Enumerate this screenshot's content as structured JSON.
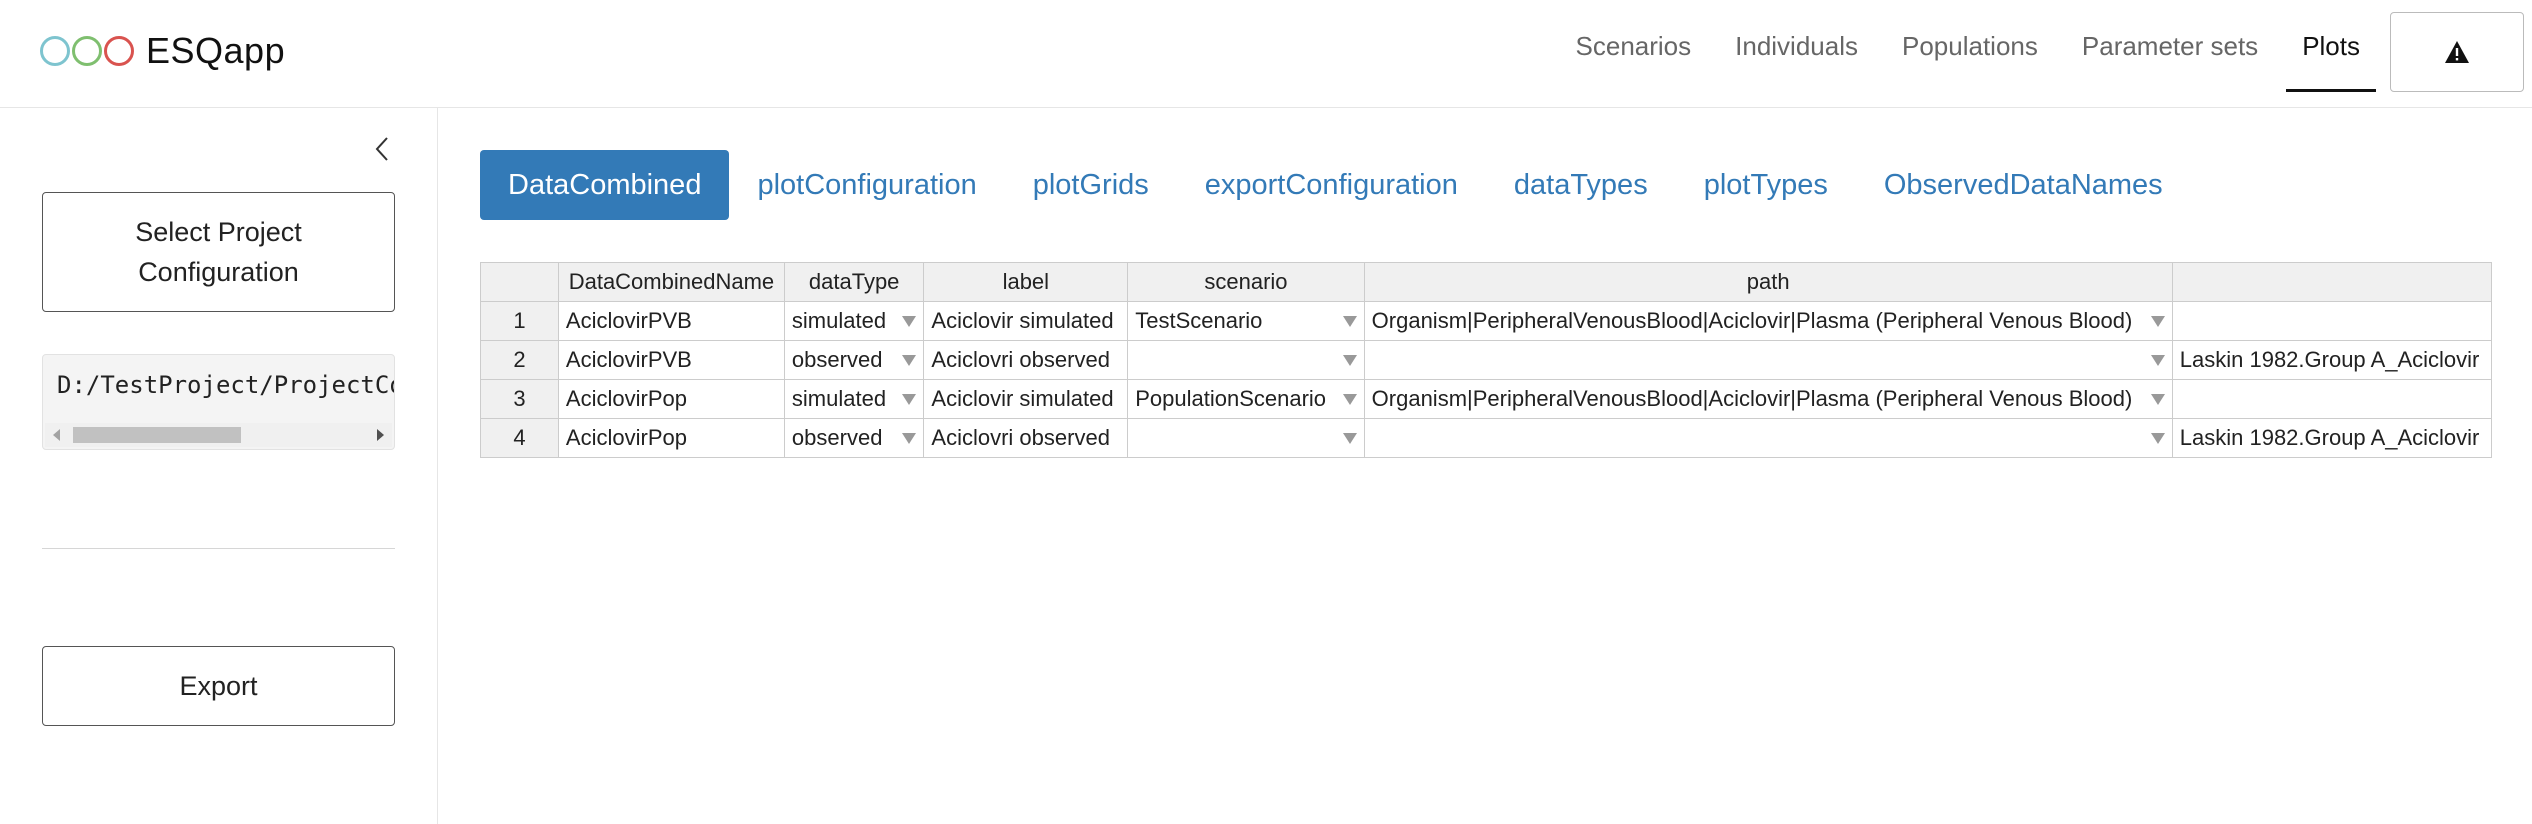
{
  "app": {
    "title": "ESQapp",
    "logo_colors": [
      "#7ec4cf",
      "#7fbf6f",
      "#d9534f"
    ]
  },
  "nav": {
    "items": [
      "Scenarios",
      "Individuals",
      "Populations",
      "Parameter sets",
      "Plots"
    ],
    "active": "Plots",
    "warning_icon": "warning-triangle-icon"
  },
  "sidebar": {
    "collapse_icon": "chevron-left-icon",
    "select_label": "Select Project Configuration",
    "path_value": "D:/TestProject/ProjectConfiguration.xlsx",
    "export_label": "Export"
  },
  "tabs": {
    "items": [
      "DataCombined",
      "plotConfiguration",
      "plotGrids",
      "exportConfiguration",
      "dataTypes",
      "plotTypes",
      "ObservedDataNames"
    ],
    "active": "DataCombined"
  },
  "table": {
    "columns": [
      "",
      "DataCombinedName",
      "dataType",
      "label",
      "scenario",
      "path",
      ""
    ],
    "rows": [
      [
        "1",
        "AciclovirPVB",
        "simulated",
        "Aciclovir simulated",
        "TestScenario",
        "Organism|PeripheralVenousBlood|Aciclovir|Plasma (Peripheral Venous Blood)",
        ""
      ],
      [
        "2",
        "AciclovirPVB",
        "observed",
        "Aciclovri observed",
        "",
        "",
        "Laskin 1982.Group A_Aciclovir"
      ],
      [
        "3",
        "AciclovirPop",
        "simulated",
        "Aciclovir simulated",
        "PopulationScenario",
        "Organism|PeripheralVenousBlood|Aciclovir|Plasma (Peripheral Venous Blood)",
        ""
      ],
      [
        "4",
        "AciclovirPop",
        "observed",
        "Aciclovri observed",
        "",
        "",
        "Laskin 1982.Group A_Aciclovir"
      ]
    ]
  }
}
